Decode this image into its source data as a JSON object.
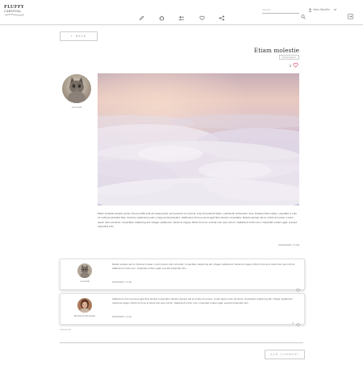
{
  "header": {
    "logo_line1": "FLUFFY",
    "logo_line2": "CARNIVAL",
    "search_placeholder": "Search",
    "user_name": "Imhu Nonifer",
    "nav_icons": [
      "pencil-icon",
      "home-icon",
      "users-icon",
      "heart-icon",
      "share-icon"
    ]
  },
  "back_label": "←  BACK",
  "post": {
    "title": "Etiam molestie",
    "tag": "lorem ipsum",
    "likes": "2",
    "author": "Luna Kat",
    "body": "Etiam molestie semper auctor. Fusce mattis erat sit massa porta, sed euismod orci lacinia. Cras ut hendrerit libero, sollicitudin fermentum risus. Praesent felis metus, vulputate in odio ut, vehicula pharetra felis. Vivamus vestibulum justo congue porta pharetra. Vestibulum rhoncus lacus eget felis laoreet consectetur. Nullam semper est ac mollis accumsan. Lorem ipsum dolor sit amet, consectetur adipiscing elit. Integer vestibulum maximus magna. Morbi rhoncus ut amet odio quis rutrum. Vestibulum tortor arcu, imperdiet a libero eget, suscipit imperdiet odio.",
    "date": "21/03/2023, 17:09"
  },
  "comments": [
    {
      "name": "Luna Kat",
      "text": "Nullam semper est ac mollis accumsan. Lorem ipsum dolor sit amet, consectetur adipiscing elit. Integer vestibulum maximus magna. Morbi rhoncus ut amet odio quis rutrum. Vestibulum tortor arcu, imperdiet a libero eget, suscipit imperdiet odio.",
      "date": "19/03/2023, 17:16",
      "likes": ""
    },
    {
      "name": "Mariela Dombrowski",
      "text": "Vestibulum rhoncus lacus eget felis laoreet consectetur. Nullam semper est ac mollis accumsan. Lorem ipsum dolor sit amet, consectetur adipiscing elit. Integer vestibulum maximus magna. Morbi rhoncus ut amet odio quis rutrum. Vestibulum tortor arcu, imperdiet a libero eget, suscipit imperdiet odio.",
      "date": "24/03/2023, 17:22",
      "likes": "2"
    }
  ],
  "comment_label": "Comment",
  "add_comment_label": "ADD COMMENT",
  "colors": {
    "heart": "#e05a6e",
    "border": "#cccccc"
  }
}
